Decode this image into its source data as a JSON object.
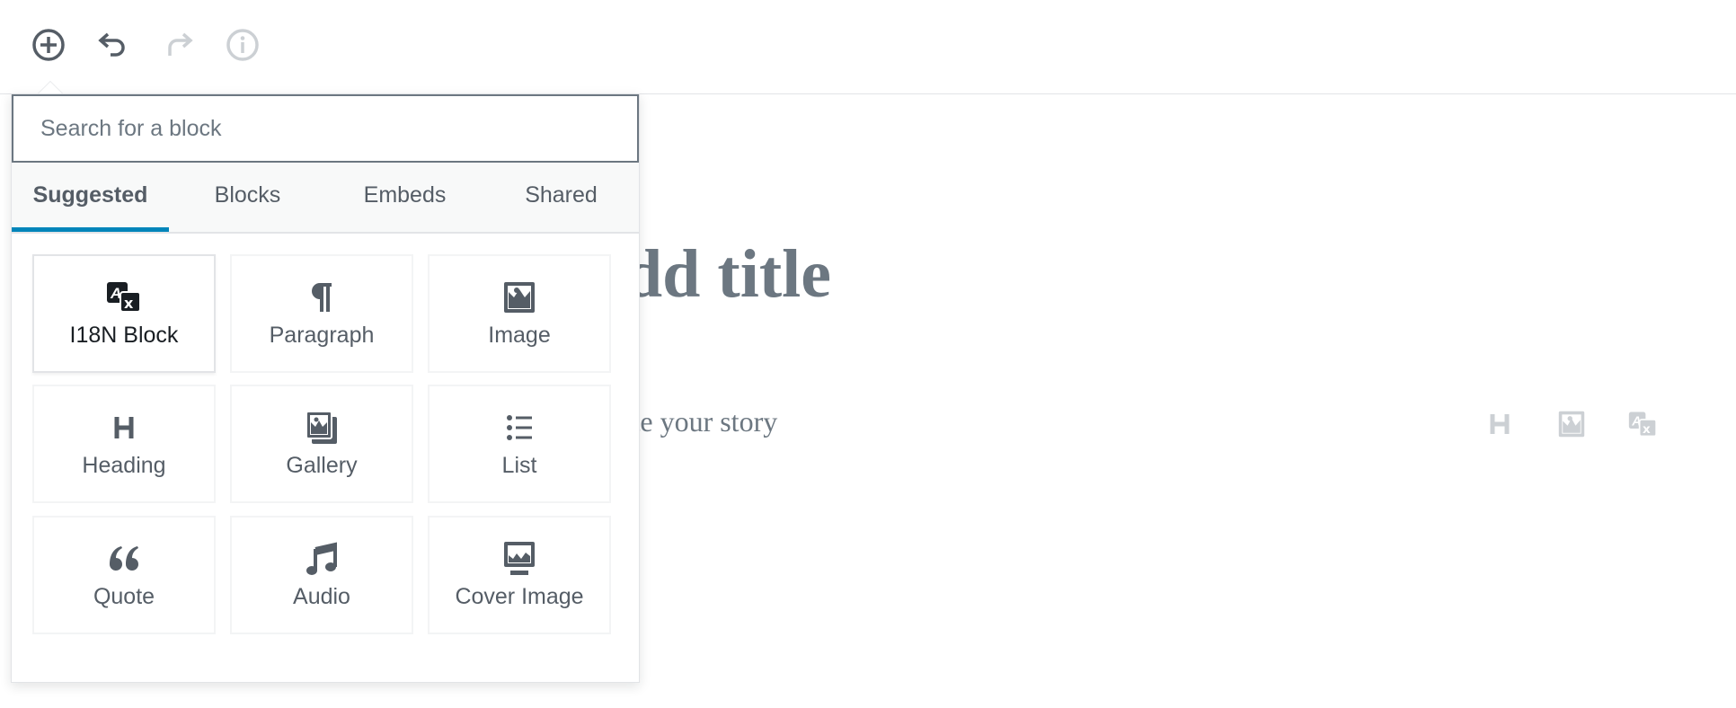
{
  "toolbar": {
    "buttons": [
      {
        "name": "add-block",
        "icon": "plus-circle-icon",
        "enabled": true
      },
      {
        "name": "undo",
        "icon": "undo-icon",
        "enabled": true
      },
      {
        "name": "redo",
        "icon": "redo-icon",
        "enabled": false
      },
      {
        "name": "info",
        "icon": "info-icon",
        "enabled": false
      }
    ]
  },
  "editor": {
    "title_placeholder": "Add title",
    "paragraph_placeholder": "Write your story",
    "quick_insert": [
      "heading-icon",
      "image-icon",
      "translation-icon"
    ]
  },
  "inserter": {
    "search_placeholder": "Search for a block",
    "search_value": "",
    "tabs": [
      {
        "label": "Suggested",
        "active": true
      },
      {
        "label": "Blocks",
        "active": false
      },
      {
        "label": "Embeds",
        "active": false
      },
      {
        "label": "Shared",
        "active": false
      }
    ],
    "blocks": [
      {
        "label": "I18N Block",
        "icon": "translation-icon"
      },
      {
        "label": "Paragraph",
        "icon": "paragraph-icon"
      },
      {
        "label": "Image",
        "icon": "image-icon"
      },
      {
        "label": "Heading",
        "icon": "heading-icon"
      },
      {
        "label": "Gallery",
        "icon": "gallery-icon"
      },
      {
        "label": "List",
        "icon": "list-icon"
      },
      {
        "label": "Quote",
        "icon": "quote-icon"
      },
      {
        "label": "Audio",
        "icon": "audio-icon"
      },
      {
        "label": "Cover Image",
        "icon": "cover-image-icon"
      }
    ]
  },
  "colors": {
    "accent": "#0085ba",
    "icon": "#555d66",
    "disabled": "#ccd0d4",
    "text": "#555d66"
  }
}
